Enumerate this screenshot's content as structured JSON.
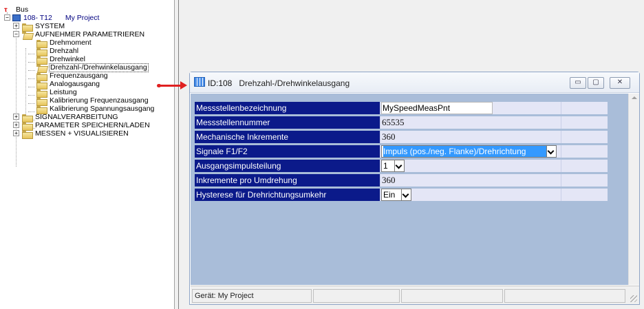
{
  "tree": {
    "root_label": "Bus",
    "device_label": "108- T12",
    "device_project": "My Project",
    "items": [
      {
        "label": "SYSTEM"
      },
      {
        "label": "AUFNEHMER PARAMETRIEREN"
      },
      {
        "label": "Drehmoment"
      },
      {
        "label": "Drehzahl"
      },
      {
        "label": "Drehwinkel"
      },
      {
        "label": "Drehzahl-/Drehwinkelausgang"
      },
      {
        "label": "Frequenzausgang"
      },
      {
        "label": "Analogausgang"
      },
      {
        "label": "Leistung"
      },
      {
        "label": "Kalibrierung Frequenzausgang"
      },
      {
        "label": "Kalibrierung Spannungsausgang"
      },
      {
        "label": "SIGNALVERARBEITUNG"
      },
      {
        "label": "PARAMETER SPEICHERN/LADEN"
      },
      {
        "label": "MESSEN + VISUALISIEREN"
      }
    ],
    "expander_plus": "+",
    "expander_minus": "−"
  },
  "window": {
    "id_label": "ID:108",
    "title": "Drehzahl-/Drehwinkelausgang",
    "minimize": "▭",
    "maximize": "▢",
    "close": "✕"
  },
  "params": [
    {
      "label": "Messstellenbezeichnung",
      "value": "MySpeedMeasPnt",
      "kind": "input"
    },
    {
      "label": "Messstellennummer",
      "value": "65535",
      "kind": "text"
    },
    {
      "label": "Mechanische Inkremente",
      "value": "360",
      "kind": "text"
    },
    {
      "label": "Signale F1/F2",
      "value": "Impuls (pos./neg. Flanke)/Drehrichtung",
      "kind": "select"
    },
    {
      "label": "Ausgangsimpulsteilung",
      "value": "1",
      "kind": "select"
    },
    {
      "label": "Inkremente pro Umdrehung",
      "value": "360",
      "kind": "text"
    },
    {
      "label": "Hysterese für Drehrichtungsumkehr",
      "value": "Ein",
      "kind": "select"
    }
  ],
  "status": {
    "device": "Gerät: My Project",
    "pane2": "",
    "pane3": "",
    "pane4": ""
  },
  "colors": {
    "label_bg": "#0b1a8a",
    "value_bg": "#e4e6f6",
    "client_bg": "#a9bdd9",
    "arrow": "#e02020"
  }
}
